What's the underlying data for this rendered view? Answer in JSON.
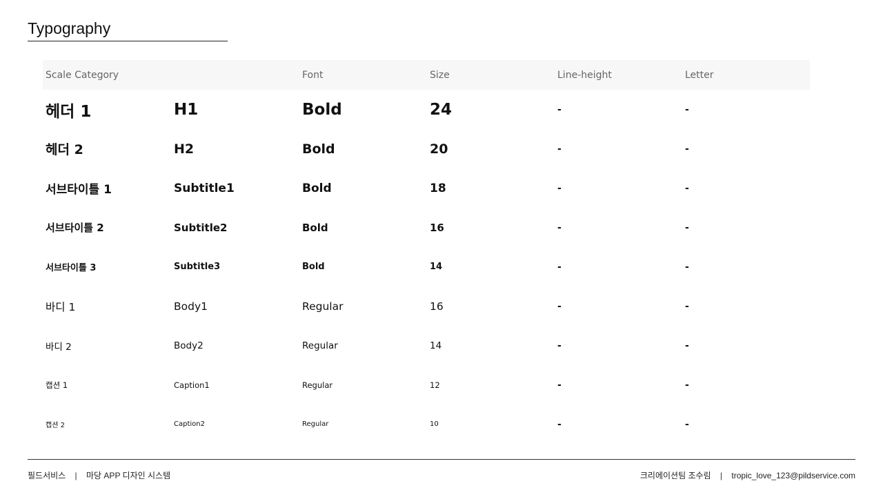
{
  "page": {
    "title": "Typography"
  },
  "table": {
    "headers": [
      "Scale Category",
      "",
      "Font",
      "Size",
      "Line-height",
      "Letter"
    ],
    "rows": [
      {
        "name": "헤더 1",
        "token": "H1",
        "font": "Bold",
        "size": "24",
        "line_height": "-",
        "letter": "-"
      },
      {
        "name": "헤더 2",
        "token": "H2",
        "font": "Bold",
        "size": "20",
        "line_height": "-",
        "letter": "-"
      },
      {
        "name": "서브타이틀 1",
        "token": "Subtitle1",
        "font": "Bold",
        "size": "18",
        "line_height": "-",
        "letter": "-"
      },
      {
        "name": "서브타이틀 2",
        "token": "Subtitle2",
        "font": "Bold",
        "size": "16",
        "line_height": "-",
        "letter": "-"
      },
      {
        "name": "서브타이틀 3",
        "token": "Subtitle3",
        "font": "Bold",
        "size": "14",
        "line_height": "-",
        "letter": "-"
      },
      {
        "name": "바디 1",
        "token": "Body1",
        "font": "Regular",
        "size": "16",
        "line_height": "-",
        "letter": "-"
      },
      {
        "name": "바디 2",
        "token": "Body2",
        "font": "Regular",
        "size": "14",
        "line_height": "-",
        "letter": "-"
      },
      {
        "name": "캡션 1",
        "token": "Caption1",
        "font": "Regular",
        "size": "12",
        "line_height": "-",
        "letter": "-"
      },
      {
        "name": "캡션 2",
        "token": "Caption2",
        "font": "Regular",
        "size": "10",
        "line_height": "-",
        "letter": "-"
      }
    ]
  },
  "footer": {
    "company": "필드서비스",
    "project": "마당 APP 디자인 시스템",
    "author": "크리에이션팀 조수림",
    "email": "tropic_love_123@pildservice.com",
    "separator": "|"
  }
}
